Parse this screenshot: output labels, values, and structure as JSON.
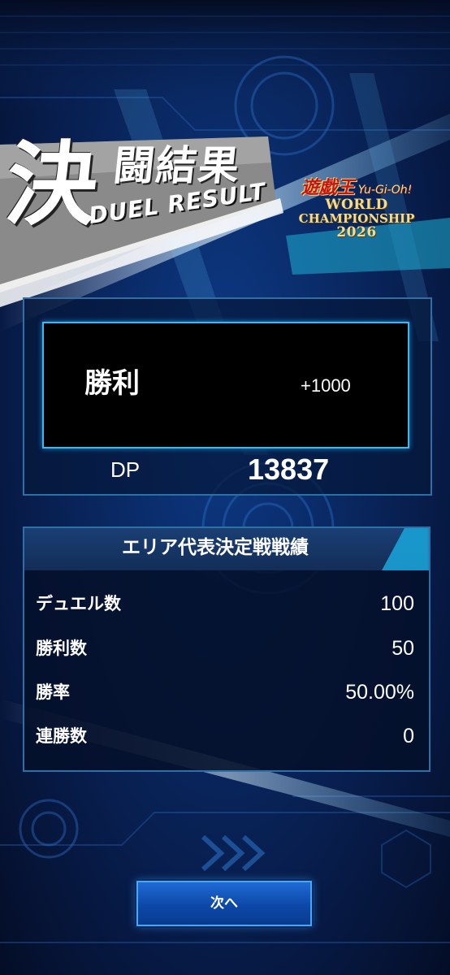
{
  "header": {
    "title_kanji_big": "決",
    "title_kanji_small": "闘結果",
    "title_en": "DUEL RESULT"
  },
  "logo": {
    "ygo_jp": "遊戯王",
    "ygo_en": "Yu-Gi-Oh!",
    "line1": "WORLD",
    "line2": "CHAMPIONSHIP",
    "line3": "2026"
  },
  "result": {
    "outcome": "勝利",
    "dp_change": "+1000",
    "dp_label": "DP",
    "dp_value": "13837"
  },
  "stats": {
    "title": "エリア代表決定戦戦績",
    "rows": [
      {
        "label": "デュエル数",
        "value": "100"
      },
      {
        "label": "勝利数",
        "value": "50"
      },
      {
        "label": "勝率",
        "value": "50.00%"
      },
      {
        "label": "連勝数",
        "value": "0"
      }
    ]
  },
  "footer": {
    "next_label": "次へ"
  },
  "colors": {
    "background": "#0a2a66",
    "accent_cyan": "#3fb6ee",
    "button_blue": "#1f6ad6",
    "logo_red": "#c4141b",
    "logo_gold": "#f5dc8c"
  }
}
